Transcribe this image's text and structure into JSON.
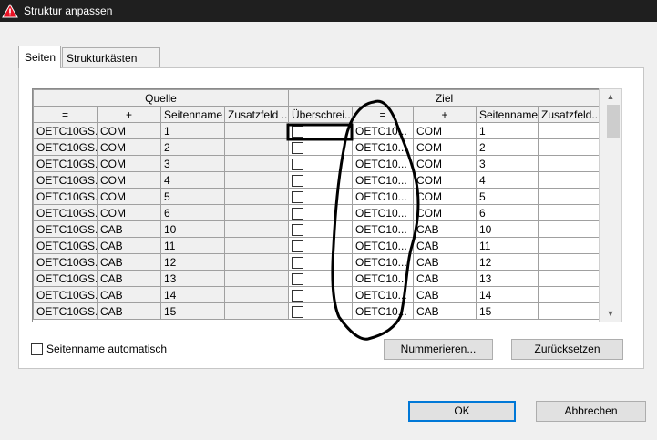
{
  "window": {
    "title": "Struktur anpassen",
    "icon": "warning-triangle-icon"
  },
  "tabs": [
    {
      "label": "Seiten",
      "active": true
    },
    {
      "label": "Strukturkästen",
      "active": false
    }
  ],
  "grid": {
    "group_headers": {
      "source": "Quelle",
      "target": "Ziel"
    },
    "columns": [
      "=",
      "+",
      "Seitenname",
      "Zusatzfeld ...",
      "Überschrei...",
      "=",
      "+",
      "Seitenname",
      "Zusatzfeld..."
    ],
    "rows": [
      {
        "src_eq": "OETC10GS...",
        "src_plus": "COM",
        "src_page": "1",
        "src_extra": "",
        "overwrite": false,
        "tgt_eq": "OETC10...",
        "tgt_plus": "COM",
        "tgt_page": "1",
        "tgt_extra": ""
      },
      {
        "src_eq": "OETC10GS...",
        "src_plus": "COM",
        "src_page": "2",
        "src_extra": "",
        "overwrite": false,
        "tgt_eq": "OETC10...",
        "tgt_plus": "COM",
        "tgt_page": "2",
        "tgt_extra": ""
      },
      {
        "src_eq": "OETC10GS...",
        "src_plus": "COM",
        "src_page": "3",
        "src_extra": "",
        "overwrite": false,
        "tgt_eq": "OETC10...",
        "tgt_plus": "COM",
        "tgt_page": "3",
        "tgt_extra": ""
      },
      {
        "src_eq": "OETC10GS...",
        "src_plus": "COM",
        "src_page": "4",
        "src_extra": "",
        "overwrite": false,
        "tgt_eq": "OETC10...",
        "tgt_plus": "COM",
        "tgt_page": "4",
        "tgt_extra": ""
      },
      {
        "src_eq": "OETC10GS...",
        "src_plus": "COM",
        "src_page": "5",
        "src_extra": "",
        "overwrite": false,
        "tgt_eq": "OETC10...",
        "tgt_plus": "COM",
        "tgt_page": "5",
        "tgt_extra": ""
      },
      {
        "src_eq": "OETC10GS...",
        "src_plus": "COM",
        "src_page": "6",
        "src_extra": "",
        "overwrite": false,
        "tgt_eq": "OETC10...",
        "tgt_plus": "COM",
        "tgt_page": "6",
        "tgt_extra": ""
      },
      {
        "src_eq": "OETC10GS...",
        "src_plus": "CAB",
        "src_page": "10",
        "src_extra": "",
        "overwrite": false,
        "tgt_eq": "OETC10...",
        "tgt_plus": "CAB",
        "tgt_page": "10",
        "tgt_extra": ""
      },
      {
        "src_eq": "OETC10GS...",
        "src_plus": "CAB",
        "src_page": "11",
        "src_extra": "",
        "overwrite": false,
        "tgt_eq": "OETC10...",
        "tgt_plus": "CAB",
        "tgt_page": "11",
        "tgt_extra": ""
      },
      {
        "src_eq": "OETC10GS...",
        "src_plus": "CAB",
        "src_page": "12",
        "src_extra": "",
        "overwrite": false,
        "tgt_eq": "OETC10...",
        "tgt_plus": "CAB",
        "tgt_page": "12",
        "tgt_extra": ""
      },
      {
        "src_eq": "OETC10GS...",
        "src_plus": "CAB",
        "src_page": "13",
        "src_extra": "",
        "overwrite": false,
        "tgt_eq": "OETC10...",
        "tgt_plus": "CAB",
        "tgt_page": "13",
        "tgt_extra": ""
      },
      {
        "src_eq": "OETC10GS...",
        "src_plus": "CAB",
        "src_page": "14",
        "src_extra": "",
        "overwrite": false,
        "tgt_eq": "OETC10...",
        "tgt_plus": "CAB",
        "tgt_page": "14",
        "tgt_extra": ""
      },
      {
        "src_eq": "OETC10GS...",
        "src_plus": "CAB",
        "src_page": "15",
        "src_extra": "",
        "overwrite": false,
        "tgt_eq": "OETC10...",
        "tgt_plus": "CAB",
        "tgt_page": "15",
        "tgt_extra": ""
      }
    ]
  },
  "options": {
    "auto_page_name_label": "Seitenname automatisch",
    "auto_page_name_checked": false
  },
  "buttons": {
    "number": "Nummerieren...",
    "reset": "Zurücksetzen",
    "ok": "OK",
    "cancel": "Abbrechen"
  },
  "colors": {
    "titlebar": "#1f1f1f",
    "accent": "#0078d7",
    "warning_icon": "#e81123"
  }
}
